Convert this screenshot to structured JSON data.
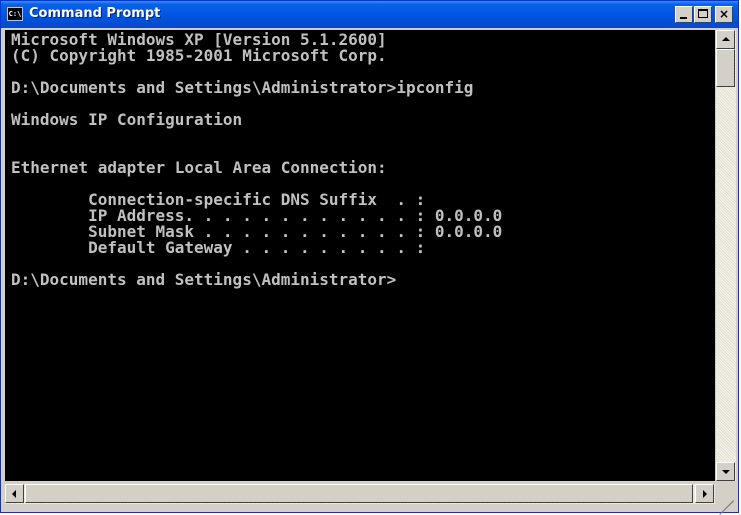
{
  "window": {
    "title": "Command Prompt",
    "icon_label": "C:\\"
  },
  "titlebar_buttons": {
    "minimize_icon": "minimize-icon",
    "maximize_icon": "maximize-icon",
    "close_label": "×"
  },
  "console": {
    "lines": [
      "Microsoft Windows XP [Version 5.1.2600]",
      "(C) Copyright 1985-2001 Microsoft Corp.",
      "",
      "D:\\Documents and Settings\\Administrator>ipconfig",
      "",
      "Windows IP Configuration",
      "",
      "",
      "Ethernet adapter Local Area Connection:",
      "",
      "        Connection-specific DNS Suffix  . :",
      "        IP Address. . . . . . . . . . . . : 0.0.0.0",
      "        Subnet Mask . . . . . . . . . . . : 0.0.0.0",
      "        Default Gateway . . . . . . . . . :",
      "",
      "D:\\Documents and Settings\\Administrator>"
    ]
  },
  "colors": {
    "console_bg": "#000000",
    "console_fg": "#c0c0c0",
    "titlebar": "#0058e6"
  }
}
